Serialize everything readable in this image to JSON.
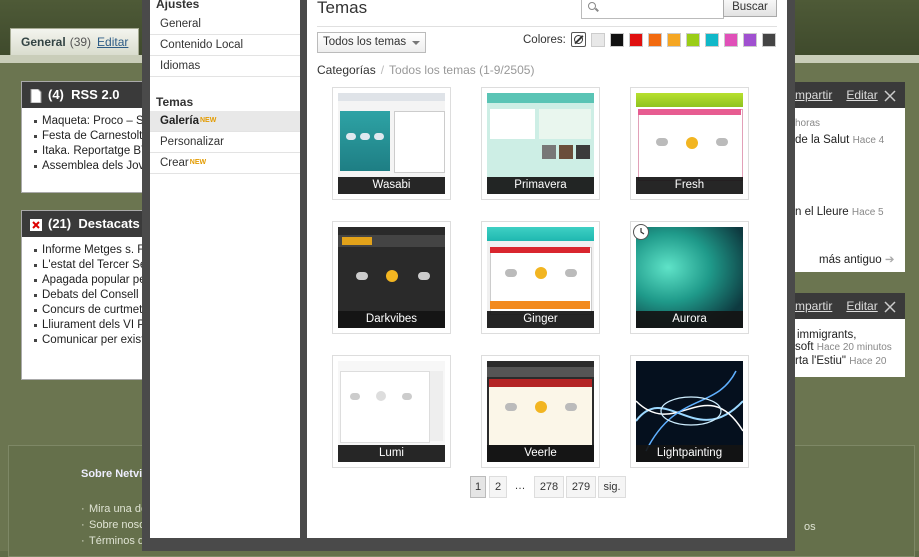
{
  "background": {
    "tab": {
      "label": "General",
      "count": "(39)",
      "edit": "Editar"
    },
    "rss_widget": {
      "count": "(4)",
      "title": "RSS 2.0",
      "items": [
        "Maqueta: Proco – Se",
        "Festa de Carnestolte",
        "Itaka. Reportatge BT",
        "Assemblea dels Joves"
      ]
    },
    "destacats_widget": {
      "count": "(21)",
      "title": "Destacats d",
      "items": [
        "Informe Metges s. Fr",
        "L'estat del Tercer Sec",
        "Apagada popular pel",
        "Debats del Consell de",
        "Concurs de curtmetra",
        "Lliurament dels VI Pre",
        "Comunicar per existir"
      ]
    },
    "right_widget_1": {
      "share": "mpartir",
      "edit": "Editar",
      "line1": "horas",
      "line2": "de la Salut",
      "line2_time": "Hace 4",
      "line3": "n el Lleure",
      "line3_time": "Hace 5",
      "more": "más antiguo"
    },
    "right_widget_2": {
      "share": "mpartir",
      "edit": "Editar",
      "line1": "immigrants,",
      "line2": "soft",
      "line2_time": "Hace 20 minutos",
      "line3": "rta l'Estiu\"",
      "line3_time": "Hace 20"
    },
    "footer": {
      "title": "Sobre Netvi",
      "links": [
        "Mira una de",
        "Sobre noso",
        "Términos de"
      ],
      "right": "os"
    }
  },
  "sidebar": {
    "ajustes_header": "Ajustes",
    "ajustes_items": [
      "General",
      "Contenido Local",
      "Idiomas"
    ],
    "temas_header": "Temas",
    "temas_items": [
      {
        "label": "Galería",
        "badge": "NEW"
      },
      {
        "label": "Personalizar",
        "badge": ""
      },
      {
        "label": "Crear",
        "badge": "NEW"
      }
    ]
  },
  "main": {
    "title": "Temas",
    "search": {
      "placeholder": "",
      "button": "Buscar"
    },
    "filter_select": "Todos los temas",
    "colors_label": "Colores:",
    "colors": [
      "#e8e8e8",
      "#111111",
      "#e01010",
      "#f26a10",
      "#f5a623",
      "#9acd17",
      "#10b8c8",
      "#e050b8",
      "#a050d0",
      "#444444"
    ],
    "breadcrumb": {
      "root": "Categorías",
      "current": "Todos los temas (1-9/2505)"
    },
    "themes": [
      "Wasabi",
      "Primavera",
      "Fresh",
      "Darkvibes",
      "Ginger",
      "Aurora",
      "Lumi",
      "Veerle",
      "Lightpainting"
    ],
    "pagination": {
      "pages": [
        "1",
        "2",
        "…",
        "278",
        "279"
      ],
      "next": "sig."
    }
  }
}
